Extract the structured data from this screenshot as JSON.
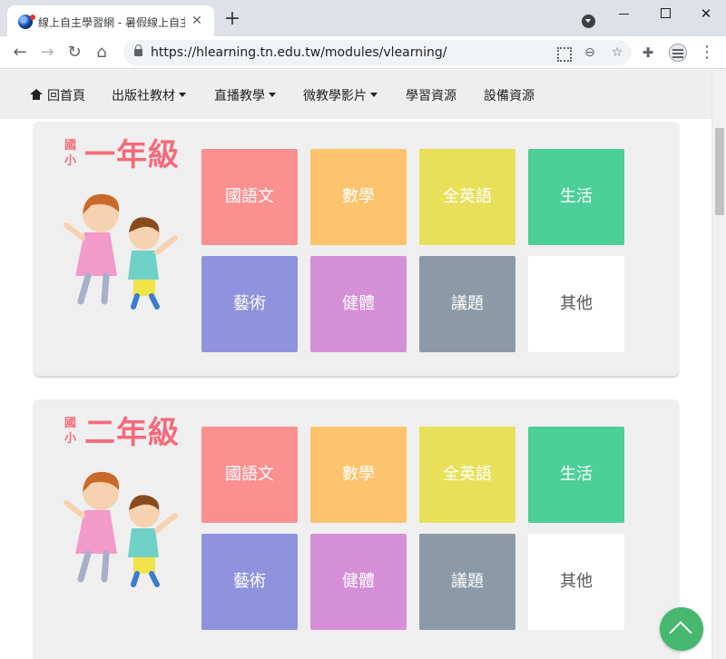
{
  "browser": {
    "tab_title": "線上自主學習網 - 暑假線上自主學",
    "url": "https://hlearning.tn.edu.tw/modules/vlearning/",
    "icons": [
      "favicon",
      "close-icon",
      "plus-icon",
      "tab-search-icon",
      "minimize-icon",
      "maximize-icon",
      "close-window-icon",
      "back-icon",
      "forward-icon",
      "reload-icon",
      "home-icon",
      "lock-icon",
      "qr-code-icon",
      "zoom-icon",
      "star-icon",
      "puzzle-icon",
      "profile-icon",
      "kebab-menu-icon"
    ]
  },
  "nav": {
    "home": "回首頁",
    "publisher": "出版社教材",
    "live": "直播教學",
    "micro": "微教學影片",
    "resources": "學習資源",
    "equipment": "設備資源"
  },
  "grades": [
    {
      "prefix": "國小",
      "name": "一年級",
      "subjects": [
        {
          "label": "國語文",
          "color": "#fb9090"
        },
        {
          "label": "數學",
          "color": "#fdc46d"
        },
        {
          "label": "全英語",
          "color": "#e9e05a"
        },
        {
          "label": "生活",
          "color": "#4ccf98"
        },
        {
          "label": "藝術",
          "color": "#8f93dd"
        },
        {
          "label": "健體",
          "color": "#d58fd7"
        },
        {
          "label": "議題",
          "color": "#8b9aa6"
        },
        {
          "label": "其他",
          "color": "#ffffff"
        }
      ]
    },
    {
      "prefix": "國小",
      "name": "二年級",
      "subjects": [
        {
          "label": "國語文",
          "color": "#fb9090"
        },
        {
          "label": "數學",
          "color": "#fdc46d"
        },
        {
          "label": "全英語",
          "color": "#e9e05a"
        },
        {
          "label": "生活",
          "color": "#4ccf98"
        },
        {
          "label": "藝術",
          "color": "#8f93dd"
        },
        {
          "label": "健體",
          "color": "#d58fd7"
        },
        {
          "label": "議題",
          "color": "#8b9aa6"
        },
        {
          "label": "其他",
          "color": "#ffffff"
        }
      ]
    }
  ],
  "colors": {
    "grade_title": "#f46b7b",
    "card_bg": "#efefef",
    "back_to_top": "#46b86f"
  }
}
